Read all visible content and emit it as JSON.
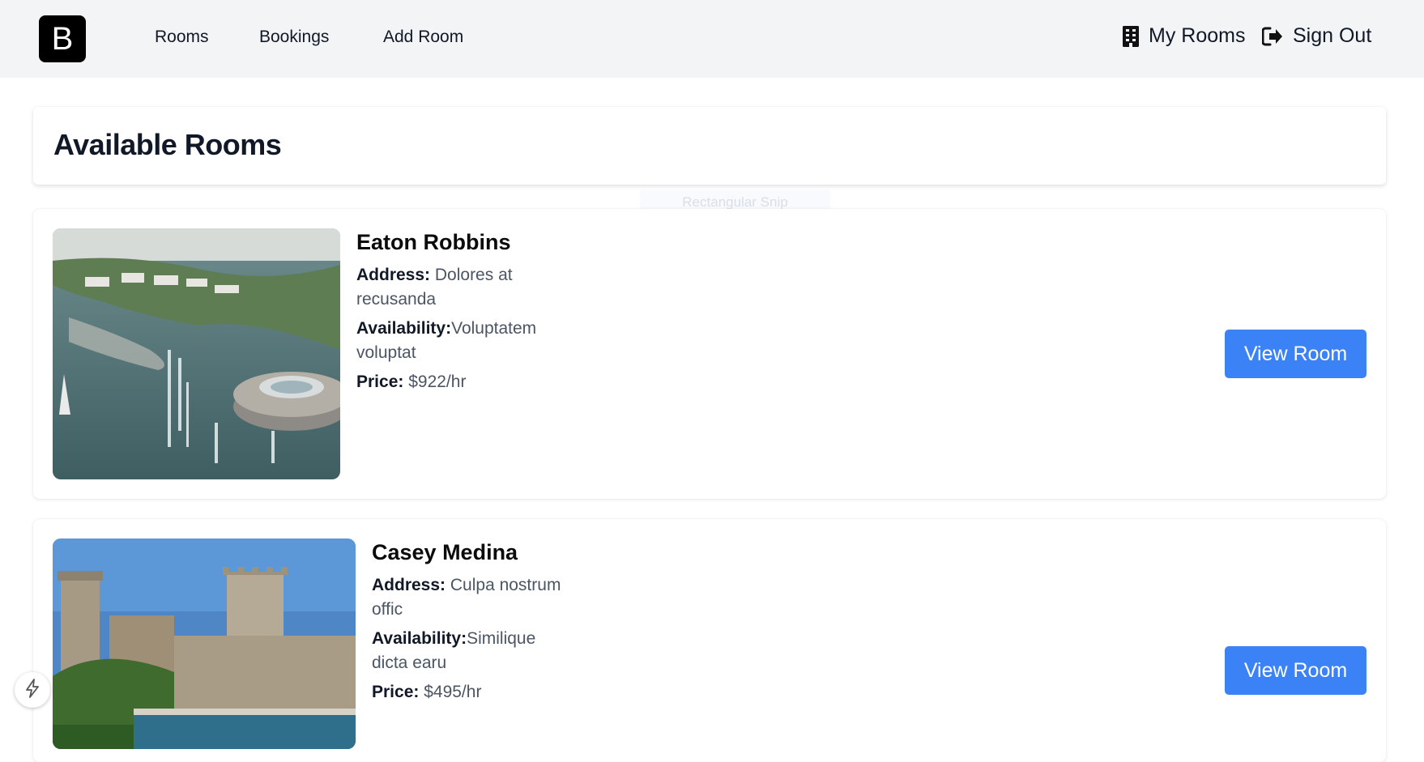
{
  "nav": {
    "logo": "B",
    "links": [
      "Rooms",
      "Bookings",
      "Add Room"
    ],
    "my_rooms": "My Rooms",
    "sign_out": "Sign Out"
  },
  "page": {
    "title": "Available Rooms",
    "ghost_tooltip": "Rectangular Snip"
  },
  "rooms": [
    {
      "name": "Eaton Robbins",
      "address_label": "Address:",
      "address": "Dolores at recusanda",
      "availability_label": "Availability:",
      "availability": "Voluptatem voluptat",
      "price_label": "Price:",
      "price": "$922/hr",
      "button": "View Room"
    },
    {
      "name": "Casey Medina",
      "address_label": "Address:",
      "address": "Culpa nostrum offic",
      "availability_label": "Availability:",
      "availability": "Similique dicta earu",
      "price_label": "Price:",
      "price": "$495/hr",
      "button": "View Room"
    }
  ],
  "colors": {
    "accent": "#3b82f6",
    "nav_bg": "#f3f4f6"
  }
}
